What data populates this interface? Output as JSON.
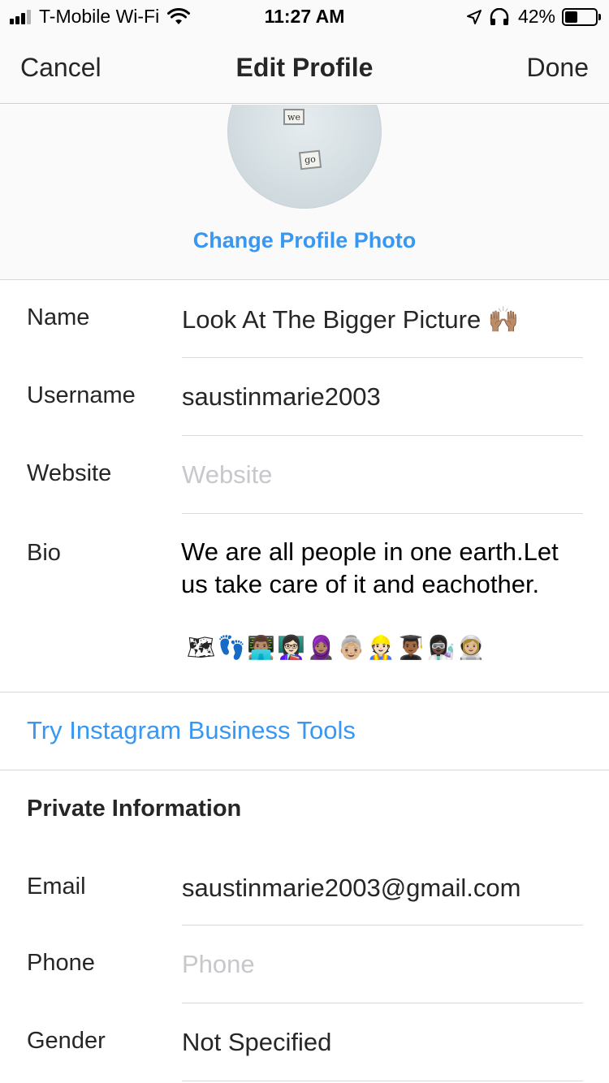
{
  "status_bar": {
    "carrier": "T-Mobile Wi-Fi",
    "time": "11:27 AM",
    "battery_percent": "42%",
    "battery_level": 0.42
  },
  "nav": {
    "cancel_label": "Cancel",
    "title": "Edit Profile",
    "done_label": "Done"
  },
  "profile_photo": {
    "tile_text_1": "we",
    "tile_text_2": "go",
    "change_label": "Change Profile Photo"
  },
  "form": {
    "name": {
      "label": "Name",
      "value": "Look At The Bigger Picture 🙌🏽"
    },
    "username": {
      "label": "Username",
      "value": "saustinmarie2003"
    },
    "website": {
      "label": "Website",
      "placeholder": "Website",
      "value": ""
    },
    "bio": {
      "label": "Bio",
      "text": "We are all people in one earth.Let us take care of it and eachother.",
      "emojis": "🗺👣👨🏽‍💻👩🏻‍🏫🧕🏽👵🏼👷🏻👨🏾‍🎓👩🏿‍🔬👩🏼‍🚀"
    }
  },
  "business_tools_label": "Try Instagram Business Tools",
  "private_info": {
    "header": "Private Information",
    "email": {
      "label": "Email",
      "value": "saustinmarie2003@gmail.com"
    },
    "phone": {
      "label": "Phone",
      "placeholder": "Phone",
      "value": ""
    },
    "gender": {
      "label": "Gender",
      "value": "Not Specified"
    }
  },
  "colors": {
    "link_blue": "#3897f0",
    "text": "#262626",
    "placeholder": "#c7c7cc",
    "divider": "#dbdbdb",
    "header_bg": "#fafafa"
  }
}
